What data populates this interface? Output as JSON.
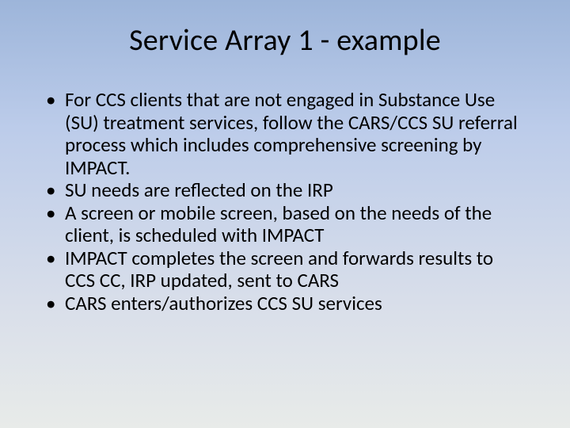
{
  "slide": {
    "title": "Service Array 1 - example",
    "bullets": [
      "For CCS clients that are not engaged in Substance Use (SU) treatment services, follow the CARS/CCS SU referral process which includes comprehensive screening by IMPACT.",
      "SU needs are reflected on the IRP",
      "A screen or mobile screen, based on the needs of the client, is scheduled with IMPACT",
      "IMPACT completes the screen and forwards results to CCS CC, IRP updated, sent to CARS",
      "CARS enters/authorizes CCS SU services"
    ]
  }
}
